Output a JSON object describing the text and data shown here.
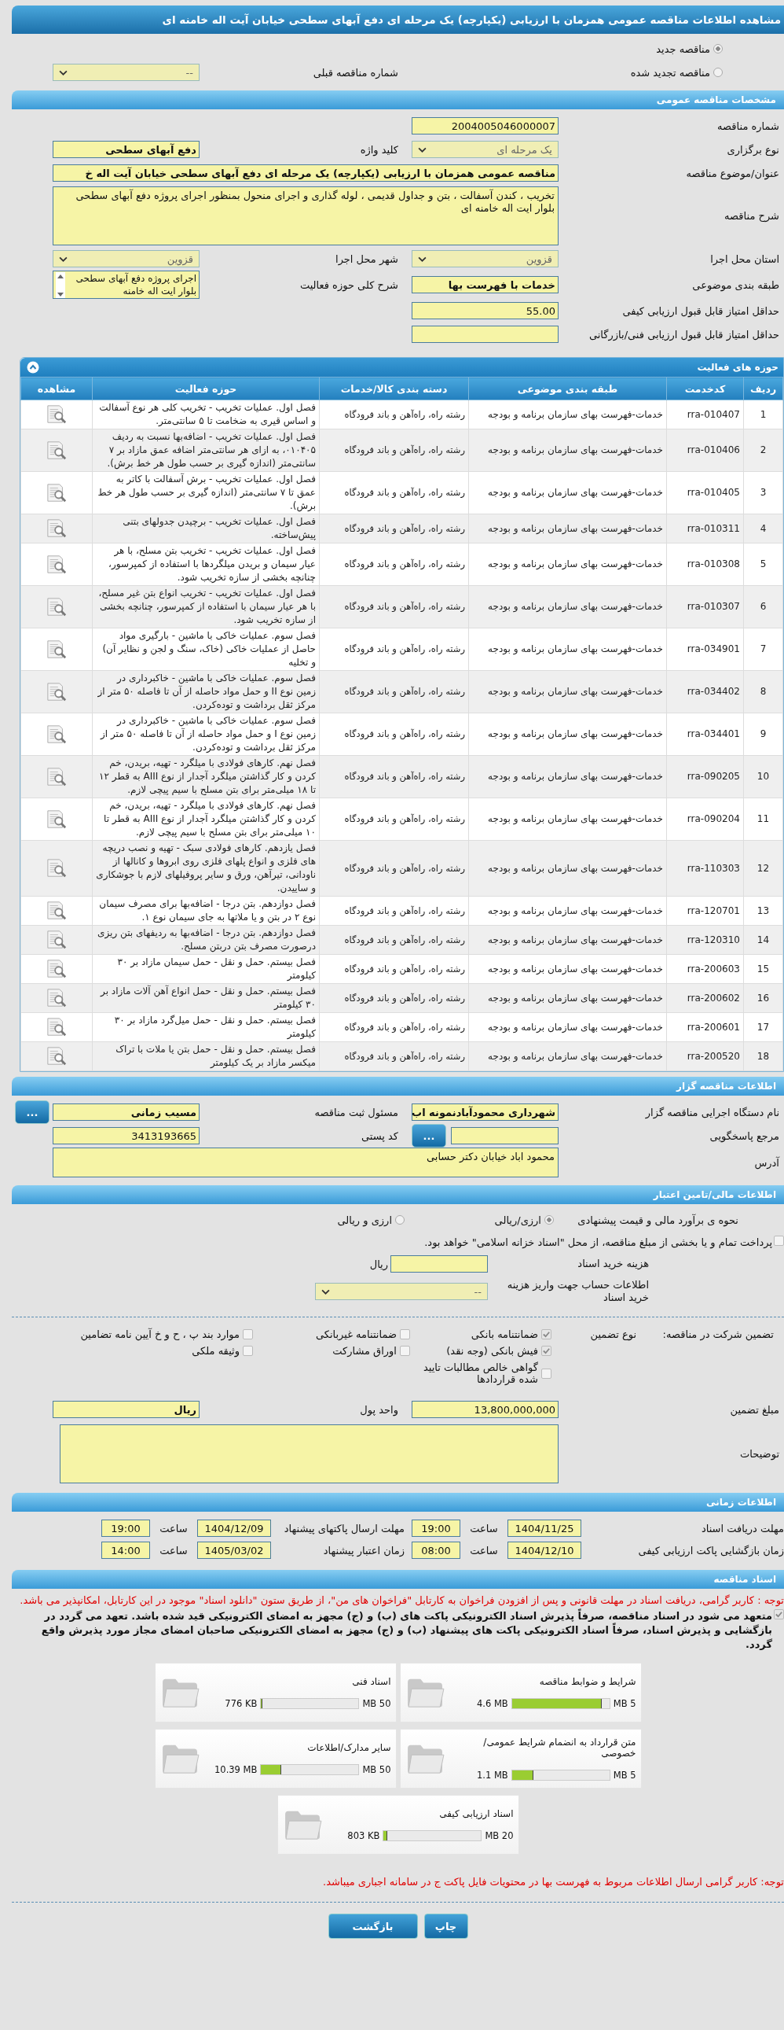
{
  "page_title": "مشاهده اطلاعات مناقصه عمومی همزمان با ارزیابی (یکپارچه) یک مرحله ای دفع آبهای سطحی خیابان آیت اله خامنه ای",
  "tender_type": [
    {
      "label": "مناقصه جدید",
      "selected": true
    },
    {
      "label": "مناقصه تجدید شده",
      "selected": false
    }
  ],
  "previous_tender": {
    "label": "شماره مناقصه قبلی",
    "value": "--"
  },
  "general": {
    "title": "مشخصات مناقصه عمومی",
    "rows": [
      [
        {
          "label": "شماره مناقصه",
          "kind": "number",
          "value": "2004005046000007"
        }
      ],
      [
        {
          "label": "نوع برگزاری",
          "kind": "select",
          "value": "یک مرحله ای"
        },
        {
          "label": "کلید واژه",
          "kind": "text",
          "value": "دفع آبهای سطحی"
        }
      ],
      [
        {
          "label": "عنوان/موضوع مناقصه",
          "kind": "longtext",
          "value": "مناقصه عمومی همزمان با ارزیابی (یکپارچه) یک مرحله ای دفع آبهای سطحی خیابان آیت اله خ"
        }
      ],
      [
        {
          "label": "شرح مناقصه",
          "kind": "textarea",
          "value": "تخریب ، کندن آسفالت ، بتن و جداول قدیمی ، لوله گذاری و اجرای منحول  بمنظور اجرای پروژه  دفع آبهای سطحی بلوار ایت اله خامنه ای"
        }
      ],
      [
        {
          "label": "استان محل اجرا",
          "kind": "select",
          "value": "قزوین"
        },
        {
          "label": "شهر محل اجرا",
          "kind": "select",
          "value": "قزوین"
        }
      ],
      [
        {
          "label": "طبقه بندی موضوعی",
          "kind": "text",
          "value": "خدمات با فهرست بها"
        },
        {
          "label": "شرح کلی حوزه فعالیت",
          "kind": "listbox",
          "value": "اجرای پروژه  دفع آبهای سطحی بلوار ایت اله خامنه"
        }
      ],
      [
        {
          "label": "حداقل امتیاز قابل قبول ارزیابی کیفی",
          "kind": "number",
          "value": "55.00"
        }
      ],
      [
        {
          "label": "حداقل امتیاز قابل قبول ارزیابی فنی/بازرگانی",
          "kind": "number"
        }
      ]
    ]
  },
  "activities": {
    "title": "حوزه های فعالیت",
    "columns": [
      "ردیف",
      "کدخدمت",
      "طبقه بندی موضوعی",
      "دسته بندی کالا/خدمات",
      "حوزه فعالیت",
      "مشاهده"
    ],
    "rows": [
      {
        "index": "1",
        "code": "rra-010407",
        "category": "خدمات-فهرست بهای سازمان برنامه و بودجه",
        "group": "رشته راه، راه‌آهن و باند فرودگاه",
        "activity": "فصل اول. عملیات تخریب - تخریب کلی هر نوع آسفالت و اساس قیری به ضخامت تا ۵ سانتی‌متر."
      },
      {
        "index": "2",
        "code": "rra-010406",
        "category": "خدمات-فهرست بهای سازمان برنامه و بودجه",
        "group": "رشته راه، راه‌آهن و باند فرودگاه",
        "activity": "فصل اول. عملیات تخریب - اضافه‌بها نسبت به ردیف ۰۱۰۴۰۵، به ازای هر سانتی‌متر اضافه عمق مازاد بر ۷ سانتی‌متر (اندازه گیری بر حسب طول هر خط برش)."
      },
      {
        "index": "3",
        "code": "rra-010405",
        "category": "خدمات-فهرست بهای سازمان برنامه و بودجه",
        "group": "رشته راه، راه‌آهن و باند فرودگاه",
        "activity": "فصل اول. عملیات تخریب - برش آسفالت با کاتر به عمق تا ۷ سانتی‌متر (اندازه گیری بر حسب طول هر خط برش)."
      },
      {
        "index": "4",
        "code": "rra-010311",
        "category": "خدمات-فهرست بهای سازمان برنامه و بودجه",
        "group": "رشته راه، راه‌آهن و باند فرودگاه",
        "activity": "فصل اول. عملیات تخریب - برچیدن جدولهای بتنی پیش‌ساخته."
      },
      {
        "index": "5",
        "code": "rra-010308",
        "category": "خدمات-فهرست بهای سازمان برنامه و بودجه",
        "group": "رشته راه، راه‌آهن و باند فرودگاه",
        "activity": "فصل اول. عملیات تخریب - تخریب بتن مسلح، با هر عیار سیمان و بریدن میلگردها با استفاده از کمپرسور، چنانچه بخشی از سازه تخریب شود."
      },
      {
        "index": "6",
        "code": "rra-010307",
        "category": "خدمات-فهرست بهای سازمان برنامه و بودجه",
        "group": "رشته راه، راه‌آهن و باند فرودگاه",
        "activity": "فصل اول. عملیات تخریب - تخریب انواع بتن غیر مسلح، با هر عیار سیمان با استفاده از کمپرسور، چنانچه بخشی از سازه تخریب شود."
      },
      {
        "index": "7",
        "code": "rra-034901",
        "category": "خدمات-فهرست بهای سازمان برنامه و بودجه",
        "group": "رشته راه، راه‌آهن و باند فرودگاه",
        "activity": "فصل سوم. عملیات خاکی با ماشین - بارگیری مواد حاصل از عملیات خاکی (خاک، سنگ و لجن و نظایر آن) و تخلیه"
      },
      {
        "index": "8",
        "code": "rra-034402",
        "category": "خدمات-فهرست بهای سازمان برنامه و بودجه",
        "group": "رشته راه، راه‌آهن و باند فرودگاه",
        "activity": "فصل سوم. عملیات خاکی با ماشین - خاکبرداری در زمین نوع II و حمل مواد حاصله از آن تا فاصله ۵۰ متر از مرکز ثقل برداشت و توده‌کردن."
      },
      {
        "index": "9",
        "code": "rra-034401",
        "category": "خدمات-فهرست بهای سازمان برنامه و بودجه",
        "group": "رشته راه، راه‌آهن و باند فرودگاه",
        "activity": "فصل سوم. عملیات خاکی با ماشین - خاکبرداری در زمین نوع I و حمل مواد حاصله از آن تا فاصله ۵۰ متر از مرکز ثقل برداشت و توده‌کردن."
      },
      {
        "index": "10",
        "code": "rra-090205",
        "category": "خدمات-فهرست بهای سازمان برنامه و بودجه",
        "group": "رشته راه، راه‌آهن و باند فرودگاه",
        "activity": "فصل نهم. کارهای فولادی با میلگرد - تهیه، بریدن، خم کردن و کار گذاشتن میلگرد آجدار از نوع AIII به قطر ۱۲ تا ۱۸ میلی‌متر برای بتن مسلح با سیم پیچی لازم."
      },
      {
        "index": "11",
        "code": "rra-090204",
        "category": "خدمات-فهرست بهای سازمان برنامه و بودجه",
        "group": "رشته راه، راه‌آهن و باند فرودگاه",
        "activity": "فصل نهم. کارهای فولادی با میلگرد - تهیه، بریدن، خم کردن و کار گذاشتن میلگرد آجدار از نوع AIII به قطر تا ۱۰ میلی‌متر برای بتن مسلح با سیم پیچی لازم."
      },
      {
        "index": "12",
        "code": "rra-110303",
        "category": "خدمات-فهرست بهای سازمان برنامه و بودجه",
        "group": "رشته راه، راه‌آهن و باند فرودگاه",
        "activity": "فصل یازدهم. کارهای فولادی سبک - تهیه و نصب دریچه های فلزی و انواع پلهای فلزی روی ابروها و کانالها از ناودانی، تیرآهن، ورق و سایر پروفیلهای لازم با جوشکاری و ساییدن."
      },
      {
        "index": "13",
        "code": "rra-120701",
        "category": "خدمات-فهرست بهای سازمان برنامه و بودجه",
        "group": "رشته راه، راه‌آهن و باند فرودگاه",
        "activity": "فصل دوازدهم. بتن درجا - اضافه‌بها برای مصرف سیمان نوع ۲ در بتن و یا ملاتها به جای سیمان نوع ۱."
      },
      {
        "index": "14",
        "code": "rra-120310",
        "category": "خدمات-فهرست بهای سازمان برنامه و بودجه",
        "group": "رشته راه، راه‌آهن و باند فرودگاه",
        "activity": "فصل دوازدهم. بتن درجا - اضافه‌بها به ردیفهای بتن ریزی درصورت مصرف بتن دربتن مسلح."
      },
      {
        "index": "15",
        "code": "rra-200603",
        "category": "خدمات-فهرست بهای سازمان برنامه و بودجه",
        "group": "رشته راه، راه‌آهن و باند فرودگاه",
        "activity": "فصل بیستم. حمل و نقل - حمل سیمان مازاد بر ۳۰ کیلومتر"
      },
      {
        "index": "16",
        "code": "rra-200602",
        "category": "خدمات-فهرست بهای سازمان برنامه و بودجه",
        "group": "رشته راه، راه‌آهن و باند فرودگاه",
        "activity": "فصل بیستم. حمل و نقل -  حمل انواع آهن آلات مازاد بر ۳۰ کیلومتر"
      },
      {
        "index": "17",
        "code": "rra-200601",
        "category": "خدمات-فهرست بهای سازمان برنامه و بودجه",
        "group": "رشته راه، راه‌آهن و باند فرودگاه",
        "activity": "فصل بیستم. حمل و نقل -  حمل میل‌گرد مازاد بر ۳۰ کیلومتر"
      },
      {
        "index": "18",
        "code": "rra-200520",
        "category": "خدمات-فهرست بهای سازمان برنامه و بودجه",
        "group": "رشته راه، راه‌آهن و باند فرودگاه",
        "activity": "فصل بیستم. حمل و نقل - حمل بتن یا ملات با تراک میکسر مازاد بر یک کیلومتر"
      }
    ]
  },
  "tenderer": {
    "title": "اطلاعات مناقصه گزار",
    "rows": [
      [
        {
          "label": "نام دستگاه اجرایی مناقصه گزار",
          "kind": "text",
          "value": "شهرداری محمودآبادنمونه اب"
        },
        {
          "label": "مسئول ثبت مناقصه",
          "kind": "text",
          "value": "مسیب زمانی",
          "button": "..."
        }
      ],
      [
        {
          "label": "مرجع پاسخگویی",
          "kind": "number",
          "button": "..."
        },
        {
          "label": "کد پستی",
          "kind": "number",
          "value": "3413193665"
        }
      ],
      [
        {
          "label": "آدرس",
          "kind": "textarea",
          "value": "محمود اباد خیابان دکتر حسابی"
        }
      ]
    ]
  },
  "financial": {
    "title": "اطلاعات مالی/تامین اعتبار",
    "estimate": {
      "label": "نحوه ی برآورد مالی و قیمت پیشنهادی",
      "options": [
        {
          "label": "ارزی/ریالی",
          "selected": true
        },
        {
          "label": "ارزی و ریالی",
          "selected": false
        }
      ]
    },
    "treasury": {
      "label": "پرداخت تمام و یا بخشی از مبلغ مناقصه، از محل \"اسناد خزانه اسلامی\" خواهد بود.",
      "checked": false
    },
    "doc_fee": {
      "label": "هزینه خرید اسناد",
      "unit": "ریال"
    },
    "account": {
      "label": "اطلاعات حساب جهت واریز هزینه خرید اسناد",
      "value": "--"
    },
    "guarantee": {
      "label": "تضمین شرکت در مناقصه:",
      "type_label": "نوع تضمین",
      "options": [
        {
          "label": "ضمانتنامه بانکی",
          "checked": true
        },
        {
          "label": "ضمانتنامه غیربانکی",
          "checked": false
        },
        {
          "label": "موارد بند پ ، ح و خ آیین نامه تضامین",
          "checked": false
        },
        {
          "label": "فیش بانکی (وجه نقد)",
          "checked": true
        },
        {
          "label": "اوراق مشارکت",
          "checked": false
        },
        {
          "label": "وثیقه ملکی",
          "checked": false
        },
        {
          "label": "گواهی خالص مطالبات تایید شده قراردادها",
          "checked": false
        }
      ]
    },
    "amount": {
      "label": "مبلغ تضمین",
      "value": "13,800,000,000"
    },
    "currency": {
      "label": "واحد پول",
      "value": "ریال"
    },
    "notes": {
      "label": "توضیحات"
    }
  },
  "timing": {
    "title": "اطلاعات زمانی",
    "items": [
      {
        "label": "مهلت دریافت اسناد",
        "date": "1404/11/25",
        "time_label": "ساعت",
        "time": "19:00"
      },
      {
        "label": "مهلت ارسال پاکتهای پیشنهاد",
        "date": "1404/12/09",
        "time_label": "ساعت",
        "time": "19:00"
      },
      {
        "label": "زمان بازگشایی پاکت ارزیابی کیفی",
        "date": "1404/12/10",
        "time_label": "ساعت",
        "time": "08:00"
      },
      {
        "label": "زمان اعتبار پیشنهاد",
        "date": "1405/03/02",
        "time_label": "ساعت",
        "time": "14:00"
      }
    ]
  },
  "documents": {
    "title": "اسناد مناقصه",
    "notice": "توجه : کاربر گرامی، دریافت اسناد در مهلت قانونی و پس از افزودن فراخوان به کارتابل \"فراخوان های من\"، از طریق ستون \"دانلود اسناد\" موجود در این کارتابل، امکانپذیر می باشد.",
    "commitment": {
      "label": "متعهد می شود در اسناد مناقصه، صرفاً پذیرش اسناد الکترونیکی پاکت های (ب) و (ج) مجهز به امضای الکترونیکی قید شده باشد. تعهد می گردد در بازگشایی و پذیرش اسناد، صرفاً اسناد الکترونیکی پاکت های پیشنهاد (ب) و (ج) مجهز به امضای الکترونیکی صاحبان امضای مجاز مورد پذیرش واقع گردد.",
      "checked": true
    },
    "files": [
      {
        "title": "شرایط و ضوابط مناقصه",
        "max": "5 MB",
        "used": "4.6 MB",
        "level": 0.92
      },
      {
        "title": "اسناد فنی",
        "max": "50 MB",
        "used": "776 KB",
        "level": 0.015
      },
      {
        "title": "متن قرارداد به انضمام شرایط عمومی/خصوصی",
        "max": "5 MB",
        "used": "1.1 MB",
        "level": 0.22
      },
      {
        "title": "سایر مدارک/اطلاعات",
        "max": "50 MB",
        "used": "10.39 MB",
        "level": 0.21
      },
      {
        "title": "اسناد ارزیابی کیفی",
        "max": "20 MB",
        "used": "803 KB",
        "level": 0.04
      }
    ],
    "footer_notice": "توجه: کاربر گرامی ارسال اطلاعات مربوط به فهرست بها در محتویات فایل پاکت ج در سامانه اجباری میباشد."
  },
  "buttons": [
    "چاپ",
    "بازگشت"
  ]
}
